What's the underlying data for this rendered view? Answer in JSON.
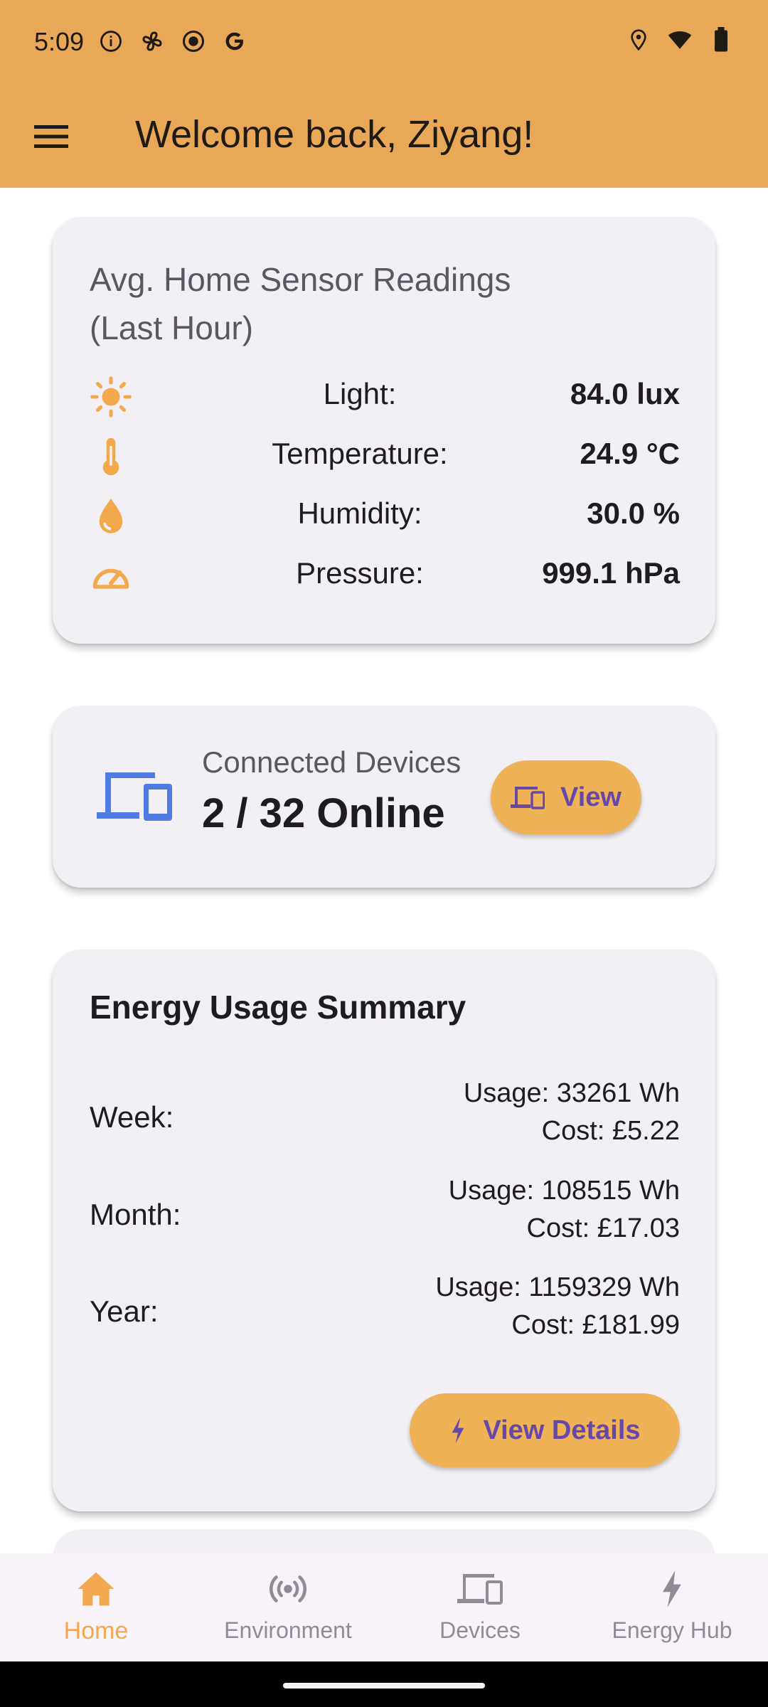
{
  "status_bar": {
    "time": "5:09",
    "left_icons": [
      "info-icon",
      "fan-icon",
      "record-icon",
      "google-icon"
    ],
    "right_icons": [
      "location-icon",
      "wifi-icon",
      "battery-icon"
    ]
  },
  "app_bar": {
    "title": "Welcome back, Ziyang!",
    "menu_icon": "menu-icon"
  },
  "sensor_card": {
    "title": "Avg. Home Sensor Readings (Last Hour)",
    "rows": [
      {
        "icon": "sun-icon",
        "label": "Light:",
        "value": "84.0 lux"
      },
      {
        "icon": "thermometer-icon",
        "label": "Temperature:",
        "value": "24.9 °C"
      },
      {
        "icon": "water-drop-icon",
        "label": "Humidity:",
        "value": "30.0 %"
      },
      {
        "icon": "gauge-icon",
        "label": "Pressure:",
        "value": "999.1 hPa"
      }
    ]
  },
  "devices_card": {
    "subtitle": "Connected Devices",
    "count": "2 / 32 Online",
    "button_label": "View"
  },
  "energy_card": {
    "title": "Energy Usage Summary",
    "rows": [
      {
        "period": "Week:",
        "usage": "Usage: 33261 Wh",
        "cost": "Cost: £5.22"
      },
      {
        "period": "Month:",
        "usage": "Usage: 108515 Wh",
        "cost": "Cost: £17.03"
      },
      {
        "period": "Year:",
        "usage": "Usage: 1159329 Wh",
        "cost": "Cost: £181.99"
      }
    ],
    "button_label": "View Details"
  },
  "bottom_nav": {
    "items": [
      {
        "label": "Home",
        "icon": "home-icon",
        "active": true
      },
      {
        "label": "Environment",
        "icon": "sensors-icon",
        "active": false
      },
      {
        "label": "Devices",
        "icon": "devices-icon",
        "active": false
      },
      {
        "label": "Energy Hub",
        "icon": "bolt-icon",
        "active": false
      }
    ]
  },
  "colors": {
    "app_bar": "#e9a857",
    "accent": "#efb257",
    "button_text": "#6548a8",
    "device_icon": "#4f7be3",
    "card_bg": "#f3f0f5"
  }
}
